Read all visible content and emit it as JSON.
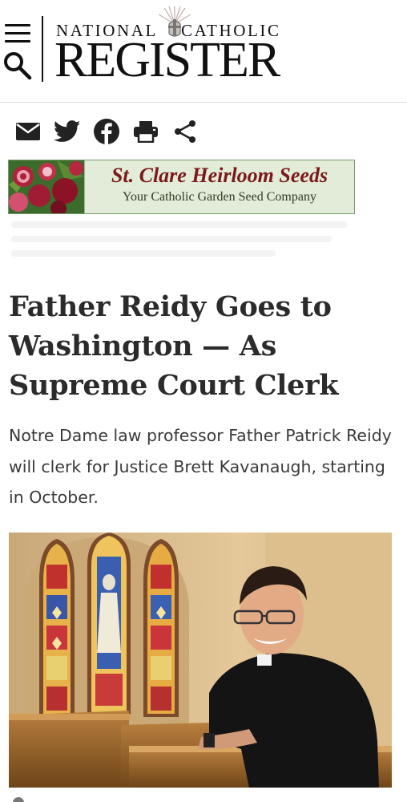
{
  "header": {
    "logo_top_left": "NATIONAL",
    "logo_top_right": "CATHOLIC",
    "logo_main": "REGISTER",
    "menu_icon": "hamburger-menu-icon",
    "search_icon": "search-icon"
  },
  "share": {
    "icons": [
      "email-icon",
      "twitter-icon",
      "facebook-icon",
      "print-icon",
      "share-icon"
    ]
  },
  "ad": {
    "title": "St. Clare Heirloom Seeds",
    "subtitle": "Your Catholic Garden Seed Company"
  },
  "article": {
    "headline": "Father Reidy Goes to Washington — As Supreme Court Clerk",
    "dek": "Notre Dame law professor Father Patrick Reidy will clerk for Justice Brett Kavanaugh, starting in October."
  },
  "colors": {
    "text_dark": "#2b2b2b",
    "ad_background": "#e2ecd8",
    "ad_title": "#7a1a1a"
  }
}
